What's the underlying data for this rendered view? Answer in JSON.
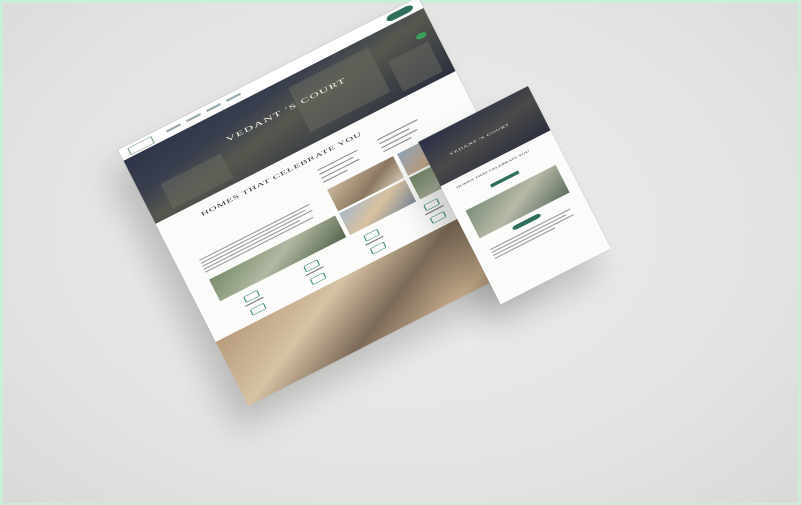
{
  "scene": {
    "description_kind": "website mockup",
    "desktop": {
      "hero_title": "VEDANT ′S COURT",
      "hero_subtitle": "",
      "section_title": "HOMES THAT CELEBRATE YOU"
    },
    "mobile": {
      "hero_title": "VEDANT ′S COURT",
      "section_title": "HOMES THAT CELEBRATE YOU"
    },
    "colors": {
      "accent": "#2f6e5c",
      "whatsapp": "#3aa05b",
      "background": "#e3e3e1",
      "frame_border": "#c9efd9"
    }
  }
}
